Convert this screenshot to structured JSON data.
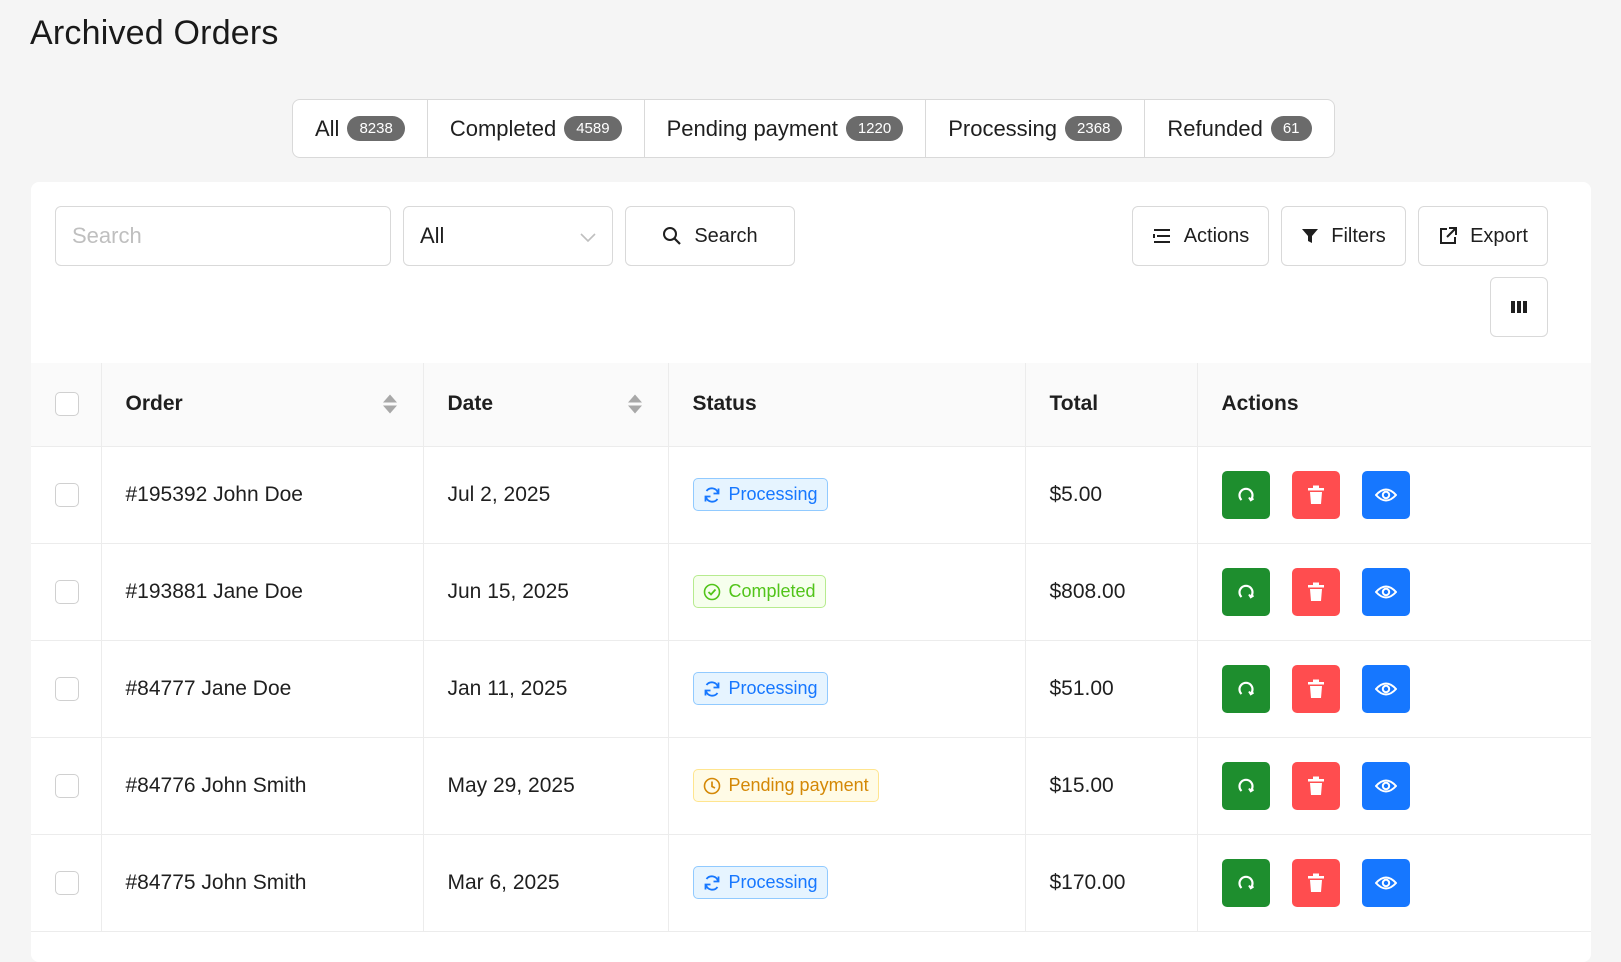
{
  "page": {
    "title": "Archived Orders"
  },
  "tabs": [
    {
      "label": "All",
      "count": "8238"
    },
    {
      "label": "Completed",
      "count": "4589"
    },
    {
      "label": "Pending payment",
      "count": "1220"
    },
    {
      "label": "Processing",
      "count": "2368"
    },
    {
      "label": "Refunded",
      "count": "61"
    }
  ],
  "toolbar": {
    "search_placeholder": "Search",
    "select_value": "All",
    "search_button": "Search",
    "actions_button": "Actions",
    "filters_button": "Filters",
    "export_button": "Export"
  },
  "table": {
    "headers": {
      "order": "Order",
      "date": "Date",
      "status": "Status",
      "total": "Total",
      "actions": "Actions"
    },
    "rows": [
      {
        "order": "#195392 John Doe",
        "date": "Jul 2, 2025",
        "status": "Processing",
        "total": "$5.00"
      },
      {
        "order": "#193881 Jane Doe",
        "date": "Jun 15, 2025",
        "status": "Completed",
        "total": "$808.00"
      },
      {
        "order": "#84777 Jane Doe",
        "date": "Jan 11, 2025",
        "status": "Processing",
        "total": "$51.00"
      },
      {
        "order": "#84776 John Smith",
        "date": "May 29, 2025",
        "status": "Pending payment",
        "total": "$15.00"
      },
      {
        "order": "#84775 John Smith",
        "date": "Mar 6, 2025",
        "status": "Processing",
        "total": "$170.00"
      }
    ]
  },
  "colors": {
    "processing": "#1677ff",
    "completed": "#52c41a",
    "pending": "#d48806",
    "restore": "#1e8e2e",
    "delete": "#ff4d4f",
    "view": "#1677ff"
  },
  "icons": {
    "row_actions": [
      "restore-icon",
      "trash-icon",
      "eye-icon"
    ],
    "toolbar": [
      "search-icon",
      "list-icon",
      "filter-icon",
      "export-icon",
      "columns-icon"
    ]
  }
}
